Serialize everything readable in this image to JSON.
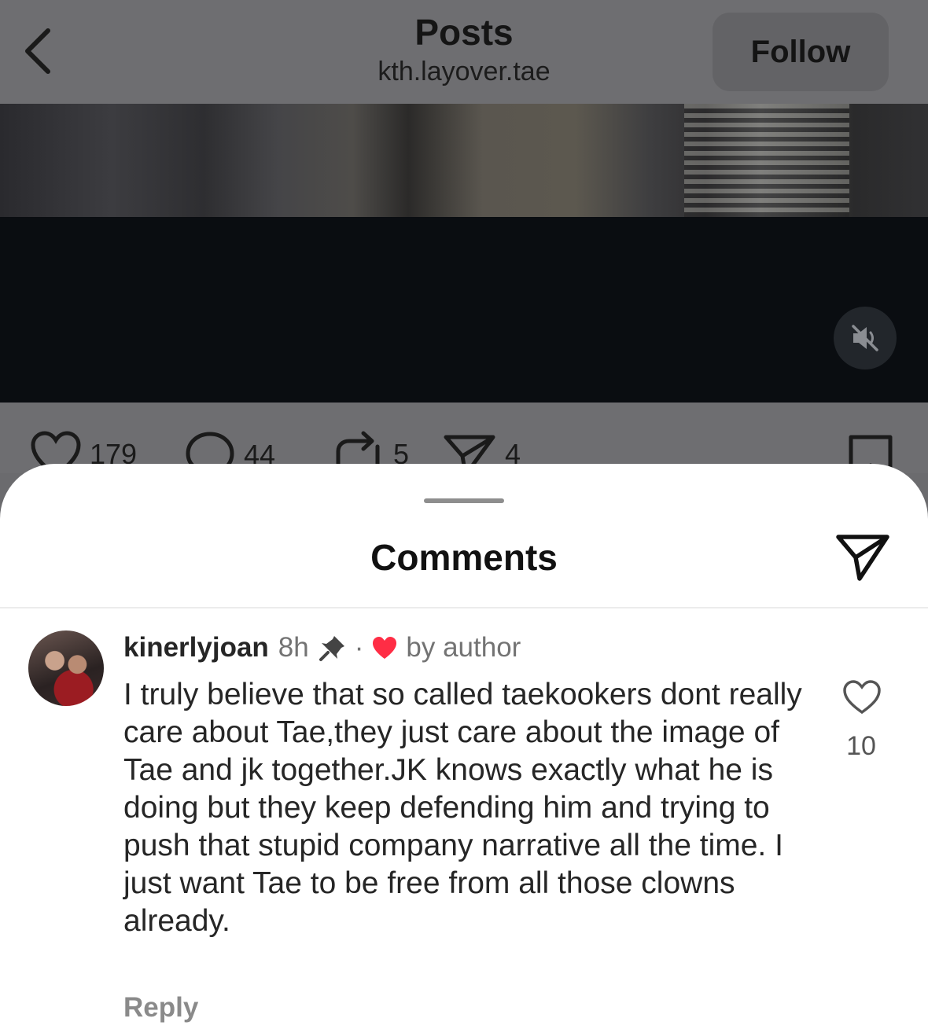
{
  "header": {
    "title": "Posts",
    "username": "kth.layover.tae",
    "follow_label": "Follow"
  },
  "post": {
    "likes": "179",
    "comments": "44",
    "reposts": "5",
    "shares": "4"
  },
  "sheet": {
    "title": "Comments",
    "comment": {
      "username": "kinerlyjoan",
      "time": "8h",
      "separator": "·",
      "liked_by_author": "by author",
      "text": "I truly believe that so called taekookers dont really care about Tae,they just care about the image of Tae and jk together.JK knows exactly what he is doing but they keep defending him and trying to push that stupid company narrative all the time. I just want Tae to be free from all those clowns already.",
      "like_count": "10",
      "reply_label": "Reply"
    }
  },
  "colors": {
    "accent_heart": "#ff2d45",
    "overlay": "#6e6e71"
  },
  "icons": [
    "back-icon",
    "volume-muted-icon",
    "heart-icon",
    "comment-icon",
    "repost-icon",
    "send-icon",
    "bookmark-icon",
    "pin-icon"
  ]
}
